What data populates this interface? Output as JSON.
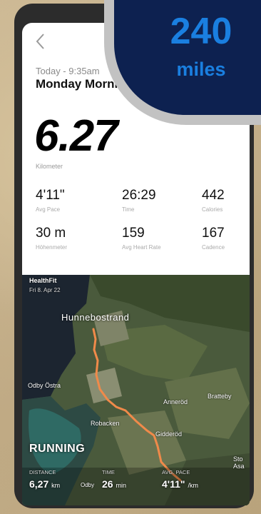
{
  "header": {
    "date_line": "Today - 9:35am",
    "activity_title": "Monday Morning Run"
  },
  "summary": {
    "distance": "6.27",
    "distance_unit": "Kilometer"
  },
  "stats": [
    {
      "value": "4'11\"",
      "label": "Avg Pace"
    },
    {
      "value": "26:29",
      "label": "Time"
    },
    {
      "value": "442",
      "label": "Calories"
    },
    {
      "value": "30 m",
      "label": "Höhenmeter"
    },
    {
      "value": "159",
      "label": "Avg Heart Rate"
    },
    {
      "value": "167",
      "label": "Cadence"
    }
  ],
  "map": {
    "app_name": "HealthFit",
    "app_date": "Fri 8. Apr 22",
    "place_labels": {
      "main_town": "Hunnebostrand",
      "odby_ostra": "Odby Östra",
      "robacken": "Robacken",
      "gidderod": "Gidderöd",
      "anneröd": "Anneröd",
      "bratteby": "Bratteby",
      "side": "Sto Asa",
      "odby": "Odby"
    },
    "activity_type": "RUNNING",
    "overlay": {
      "distance_label": "DISTANCE",
      "distance_value": "6,27",
      "distance_unit": "km",
      "time_label": "TIME",
      "time_value": "26",
      "time_unit": "min",
      "pace_label": "AVG. PACE",
      "pace_value": "4'11\"",
      "pace_unit": "/km"
    },
    "route_color": "#f08a4a"
  },
  "badge": {
    "number": "240",
    "unit": "miles",
    "accent": "#1a7fe0",
    "background": "#0d2150"
  }
}
